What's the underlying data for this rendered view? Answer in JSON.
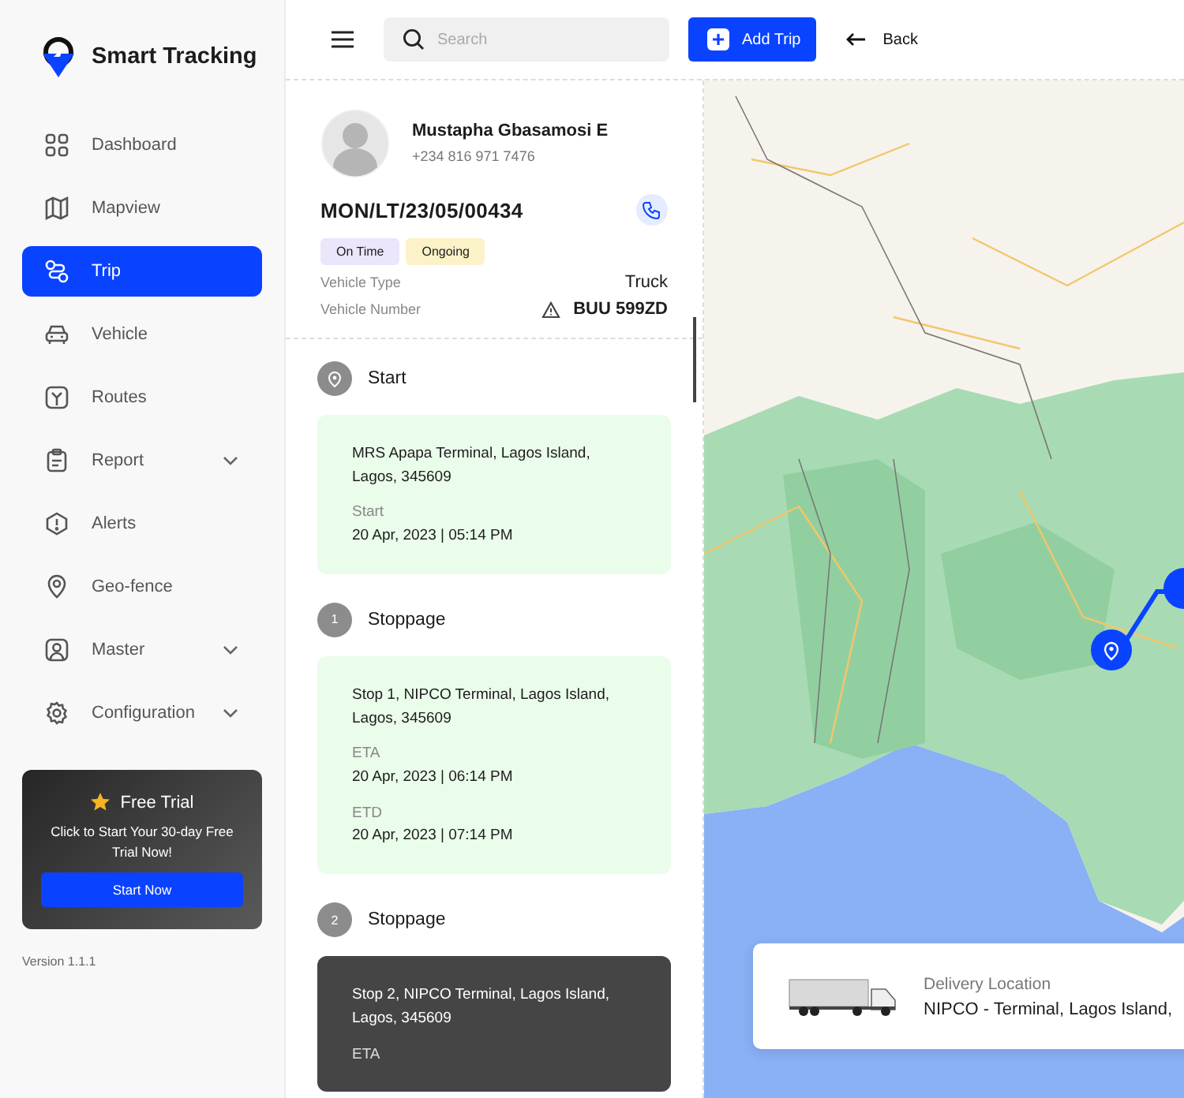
{
  "brand": {
    "name": "Smart Tracking"
  },
  "sidebar": {
    "items": [
      {
        "label": "Dashboard",
        "selected": false,
        "expandable": false
      },
      {
        "label": "Mapview",
        "selected": false,
        "expandable": false
      },
      {
        "label": "Trip",
        "selected": true,
        "expandable": false
      },
      {
        "label": "Vehicle",
        "selected": false,
        "expandable": false
      },
      {
        "label": "Routes",
        "selected": false,
        "expandable": false
      },
      {
        "label": "Report",
        "selected": false,
        "expandable": true
      },
      {
        "label": "Alerts",
        "selected": false,
        "expandable": false
      },
      {
        "label": "Geo-fence",
        "selected": false,
        "expandable": false
      },
      {
        "label": "Master",
        "selected": false,
        "expandable": true
      },
      {
        "label": "Configuration",
        "selected": false,
        "expandable": true
      }
    ],
    "promo": {
      "title": "Free Trial",
      "text": "Click to Start Your 30-day Free Trial Now!",
      "button": "Start Now"
    },
    "version": "Version 1.1.1"
  },
  "topbar": {
    "search": {
      "placeholder": "Search"
    },
    "add_button": "Add Trip",
    "back_button": "Back"
  },
  "trip": {
    "driver_name": "Mustapha Gbasamosi E",
    "phone": "+234 816 971 7476",
    "trip_id": "MON/LT/23/05/00434",
    "tags": [
      {
        "label": "On Time",
        "color": "#ece6fb"
      },
      {
        "label": "Ongoing",
        "color": "#fbf2c8"
      }
    ],
    "details": [
      {
        "label": "Vehicle Type",
        "value": "Truck",
        "warning": false
      },
      {
        "label": "Vehicle Number",
        "value": "BUU 599ZD",
        "warning": true
      }
    ]
  },
  "stops": [
    {
      "kind": "start",
      "title": "Start",
      "selected": false,
      "address": "MRS Apapa Terminal, Lagos Island, Lagos, 345609",
      "times": [
        {
          "label": "Start",
          "value": "20 Apr, 2023 | 05:14 PM"
        }
      ]
    },
    {
      "kind": "stop",
      "number": "1",
      "title": "Stoppage",
      "selected": false,
      "address": "Stop 1, NIPCO Terminal, Lagos Island, Lagos, 345609",
      "times": [
        {
          "label": "ETA",
          "value": "20 Apr, 2023 | 06:14 PM"
        },
        {
          "label": "ETD",
          "value": "20 Apr, 2023 | 07:14 PM"
        }
      ]
    },
    {
      "kind": "stop",
      "number": "2",
      "title": "Stoppage",
      "selected": true,
      "address": "Stop 2, NIPCO Terminal, Lagos Island, Lagos, 345609",
      "times": [
        {
          "label": "ETA"
        }
      ]
    }
  ],
  "delivery": {
    "label": "Delivery Location",
    "value": "NIPCO - Terminal, Lagos Island,"
  }
}
